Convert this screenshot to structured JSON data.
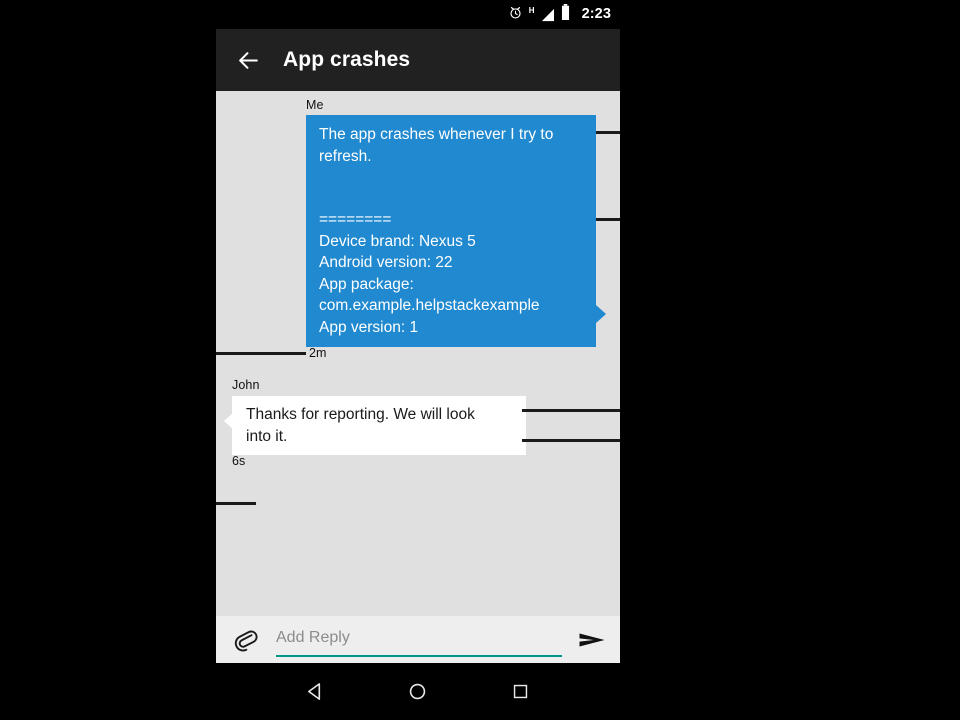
{
  "status_bar": {
    "clock": "2:23",
    "network_type": "H",
    "icons": [
      "alarm-icon",
      "signal-icon",
      "battery-icon"
    ]
  },
  "toolbar": {
    "title": "App crashes",
    "back_icon": "arrow-back-icon"
  },
  "conversation": {
    "messages": [
      {
        "sender": "Me",
        "direction": "outgoing",
        "line1": "The app crashes whenever I try to",
        "line2": "refresh.",
        "divider": "========",
        "device_brand": "Device brand: Nexus 5",
        "android_version": "Android version: 22",
        "app_package_label": "App package:",
        "app_package_value": "com.example.helpstackexample",
        "app_version": "App version: 1",
        "timestamp": "2m"
      },
      {
        "sender": "John",
        "direction": "incoming",
        "line1": "Thanks for reporting. We will look",
        "line2": "into it.",
        "timestamp": "6s"
      }
    ]
  },
  "reply_bar": {
    "attach_icon": "paperclip-icon",
    "placeholder": "Add Reply",
    "value": "",
    "send_icon": "send-icon",
    "underline_color": "#009688"
  },
  "nav_bar": {
    "back_icon": "nav-back-triangle-icon",
    "home_icon": "nav-home-circle-icon",
    "recents_icon": "nav-recents-square-icon"
  },
  "colors": {
    "toolbar": "#212121",
    "outgoing_bubble": "#2189cf",
    "incoming_bubble": "#ffffff",
    "chat_background": "#e0e0e0",
    "reply_background": "#eeeeee",
    "accent": "#009688",
    "letterbox": "#000000"
  }
}
